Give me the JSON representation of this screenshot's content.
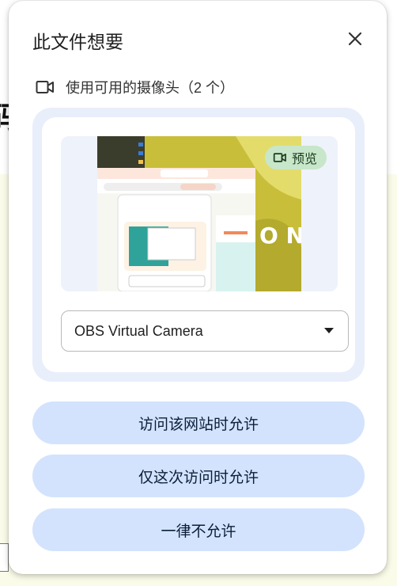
{
  "dialog": {
    "title": "此文件想要",
    "permission_text": "使用可用的摄像头（2 个）",
    "preview_label": "预览",
    "camera_select": {
      "selected": "OBS Virtual Camera"
    },
    "buttons": {
      "allow_site": "访问该网站时允许",
      "allow_once": "仅这次访问时允许",
      "never": "一律不允许"
    }
  },
  "background_page": {
    "partial_char": "码"
  },
  "colors": {
    "button_bg": "#d3e3fd",
    "panel_bg": "#e9eefb",
    "badge_bg": "#c8e6c9",
    "page_bg": "#fbfbe9"
  },
  "icons": [
    "videocam-icon",
    "close-icon",
    "dropdown-caret-icon"
  ]
}
